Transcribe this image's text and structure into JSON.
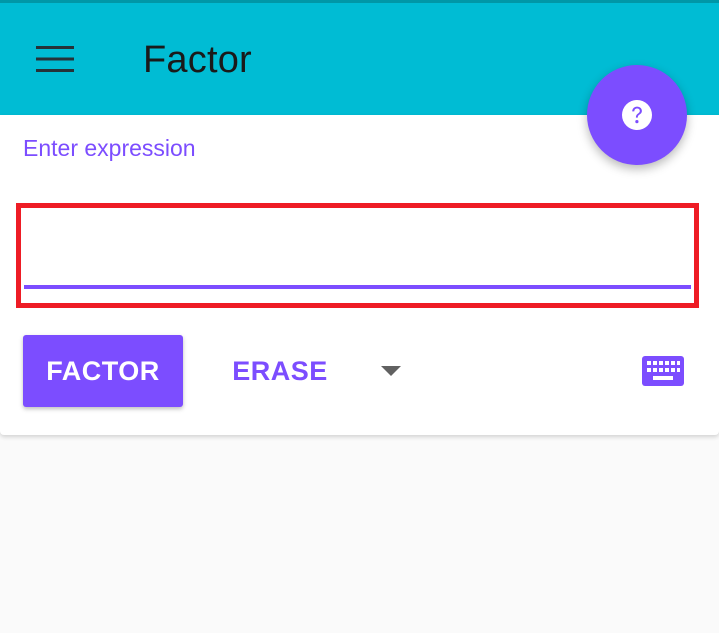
{
  "appbar": {
    "title": "Factor",
    "menu_icon": "menu-icon",
    "help_icon": "help-icon"
  },
  "colors": {
    "appbar": "#00bcd4",
    "accent": "#7c4dff",
    "highlight": "#ee1c25",
    "background": "#fafafa"
  },
  "form": {
    "label": "Enter expression",
    "input_value": "",
    "input_placeholder": "",
    "factor_button": "FACTOR",
    "erase_button": "ERASE",
    "dropdown_icon": "dropdown-arrow-icon",
    "keyboard_icon": "keyboard-icon"
  }
}
